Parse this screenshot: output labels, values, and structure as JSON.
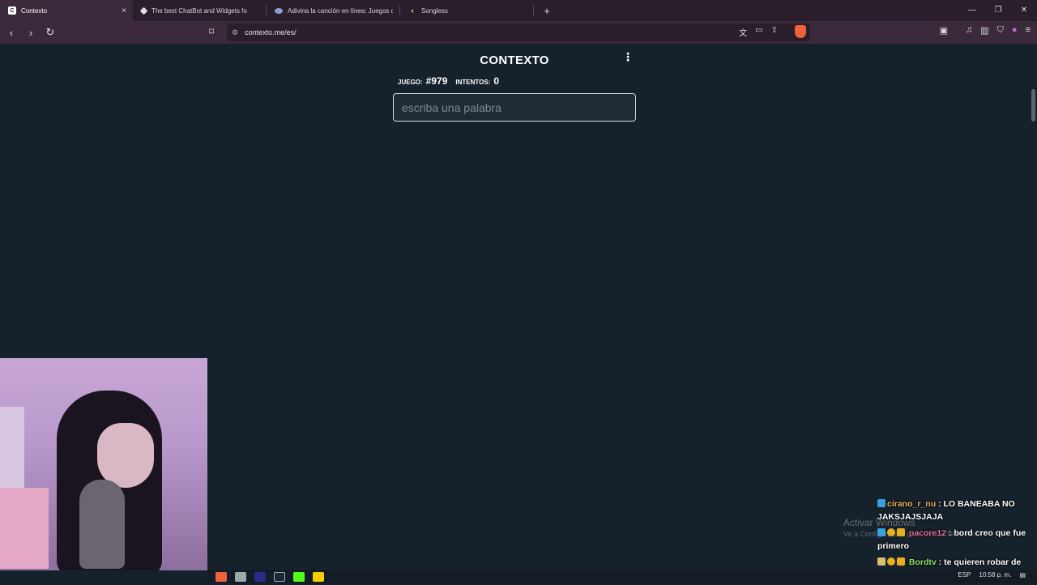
{
  "browser": {
    "tabs": [
      {
        "title": "Contexto",
        "active": true,
        "favicon": "C"
      },
      {
        "title": "The best ChatBot and Widgets fo",
        "active": false,
        "favicon": "streamelements-icon"
      },
      {
        "title": "Adivina la canción en línea: Juegos d",
        "active": false,
        "favicon": "game-icon"
      },
      {
        "title": "Songless",
        "active": false,
        "favicon": "songless-icon"
      }
    ],
    "close_glyph": "×",
    "new_tab_glyph": "+",
    "window_controls": [
      "—",
      "❐",
      "✕"
    ],
    "url": "contexto.me/es/"
  },
  "page": {
    "title": "CONTEXTO",
    "menu_glyph": "⋮",
    "game_label": "JUEGO:",
    "game_number": "#979",
    "attempts_label": "INTENTOS:",
    "attempts_value": "0",
    "input_placeholder": "escriba una palabra",
    "input_value": ""
  },
  "overlay": {
    "activate_title": "Activar Windows",
    "activate_sub": "Ve a Configuración para activar Windows.",
    "chat": [
      {
        "user": "cirano_r_nu",
        "text": "LO BANEABA NO JAKSJAJSJAJA"
      },
      {
        "user": "pacore12",
        "text": "bord creo que fue primero"
      },
      {
        "user": "Bordtv",
        "text": "te quieren robar de nuevo@gfasshug"
      }
    ]
  },
  "taskbar": {
    "lang": "ESP",
    "time": "10:58 p. m."
  },
  "colors": {
    "page_bg": "#15212b",
    "tabstrip_bg": "#2b1e2c",
    "toolbar_bg": "#3b2a3b"
  }
}
